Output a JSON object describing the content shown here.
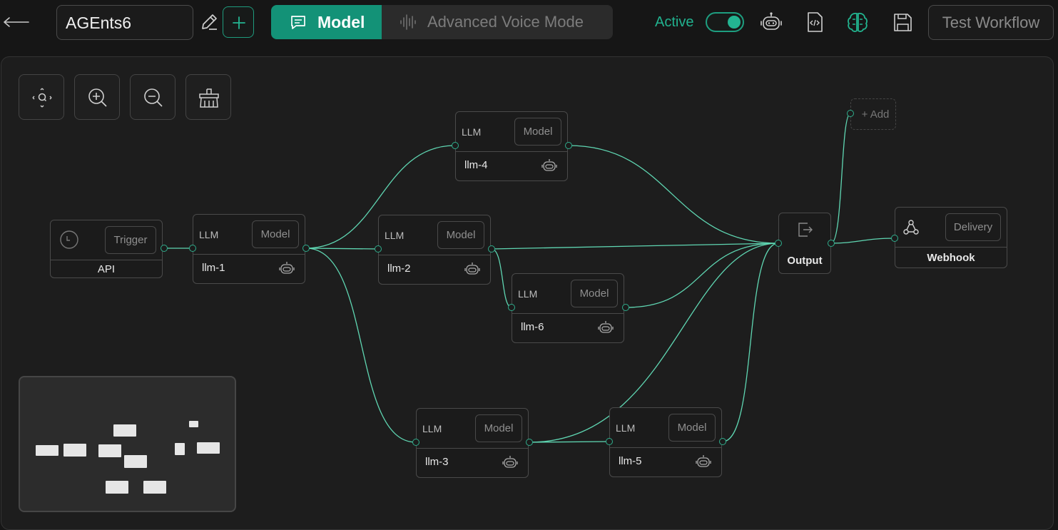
{
  "header": {
    "workflow_name": "AGEnts6",
    "mode_tabs": [
      {
        "label": "Model",
        "selected": true
      },
      {
        "label": "Advanced Voice Mode",
        "selected": false
      }
    ],
    "status_label": "Active",
    "active_toggle_on": true,
    "test_button_label": "Test Workflow",
    "icons": [
      "back-arrow-icon",
      "edit-icon",
      "plus-icon",
      "chat-icon",
      "waveform-icon",
      "robot-icon",
      "code-file-icon",
      "brain-icon",
      "save-icon"
    ]
  },
  "canvas_controls": [
    {
      "name": "fit-view",
      "icon": "fit-view-icon"
    },
    {
      "name": "zoom-in",
      "icon": "zoom-in-icon"
    },
    {
      "name": "zoom-out",
      "icon": "zoom-out-icon"
    },
    {
      "name": "clear",
      "icon": "broom-icon"
    }
  ],
  "nodes": {
    "api": {
      "type_pill": "Trigger",
      "name": "API",
      "icon": "clock-icon"
    },
    "llm1": {
      "type": "LLM",
      "pill": "Model",
      "name": "llm-1"
    },
    "llm2": {
      "type": "LLM",
      "pill": "Model",
      "name": "llm-2"
    },
    "llm3": {
      "type": "LLM",
      "pill": "Model",
      "name": "llm-3"
    },
    "llm4": {
      "type": "LLM",
      "pill": "Model",
      "name": "llm-4"
    },
    "llm5": {
      "type": "LLM",
      "pill": "Model",
      "name": "llm-5"
    },
    "llm6": {
      "type": "LLM",
      "pill": "Model",
      "name": "llm-6"
    },
    "output": {
      "name": "Output",
      "icon": "export-icon"
    },
    "webhook": {
      "type_pill": "Delivery",
      "name": "Webhook",
      "icon": "webhook-icon"
    },
    "add_placeholder": "+ Add"
  },
  "colors": {
    "accent": "#139277",
    "edge": "#5fd6b2",
    "canvas_bg": "#1d1d1d",
    "page_bg": "#161616"
  }
}
